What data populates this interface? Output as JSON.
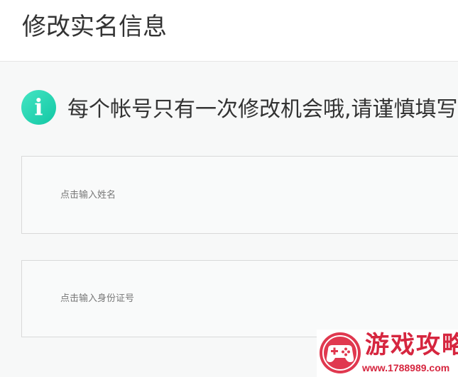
{
  "header": {
    "title": "修改实名信息"
  },
  "notice": {
    "icon": "info-icon",
    "icon_glyph": "i",
    "icon_color": "#1fd2b0",
    "text": "每个帐号只有一次修改机会哦,请谨慎填写"
  },
  "form": {
    "name_field": {
      "value": "",
      "placeholder": "点击输入姓名"
    },
    "id_field": {
      "value": "",
      "placeholder": "点击输入身份证号"
    }
  },
  "watermark": {
    "title": "游戏攻略",
    "url": "www.1788989.com",
    "color": "#d6263f"
  }
}
